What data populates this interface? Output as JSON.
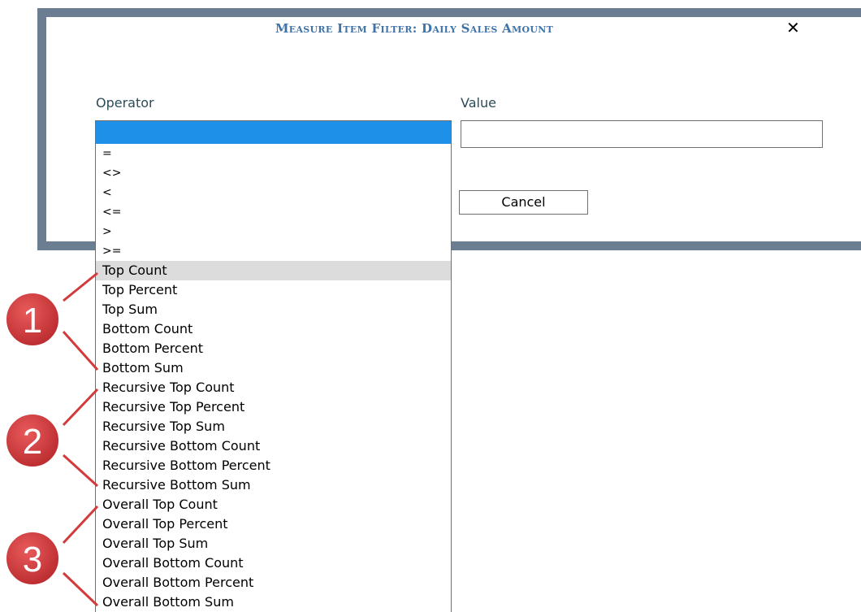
{
  "dialog": {
    "title": "Measure Item Filter: Daily Sales Amount",
    "close_glyph": "✕"
  },
  "form": {
    "operator_label": "Operator",
    "value_label": "Value",
    "value_input": "",
    "cancel_label": "Cancel"
  },
  "operator_options": [
    "",
    "=",
    "<>",
    "<",
    "<=",
    ">",
    ">=",
    "Top Count",
    "Top Percent",
    "Top Sum",
    "Bottom Count",
    "Bottom Percent",
    "Bottom Sum",
    "Recursive Top Count",
    "Recursive Top Percent",
    "Recursive Top Sum",
    "Recursive Bottom Count",
    "Recursive Bottom Percent",
    "Recursive Bottom Sum",
    "Overall Top Count",
    "Overall Top Percent",
    "Overall Top Sum",
    "Overall Bottom Count",
    "Overall Bottom Percent",
    "Overall Bottom Sum"
  ],
  "selected_option_index": 0,
  "hover_option": "Top Count",
  "callouts": [
    "1",
    "2",
    "3"
  ],
  "colors": {
    "frame": "#6b7d90",
    "title": "#3f73a8",
    "selection": "#1e90e8",
    "callout": "#d33a3c"
  }
}
